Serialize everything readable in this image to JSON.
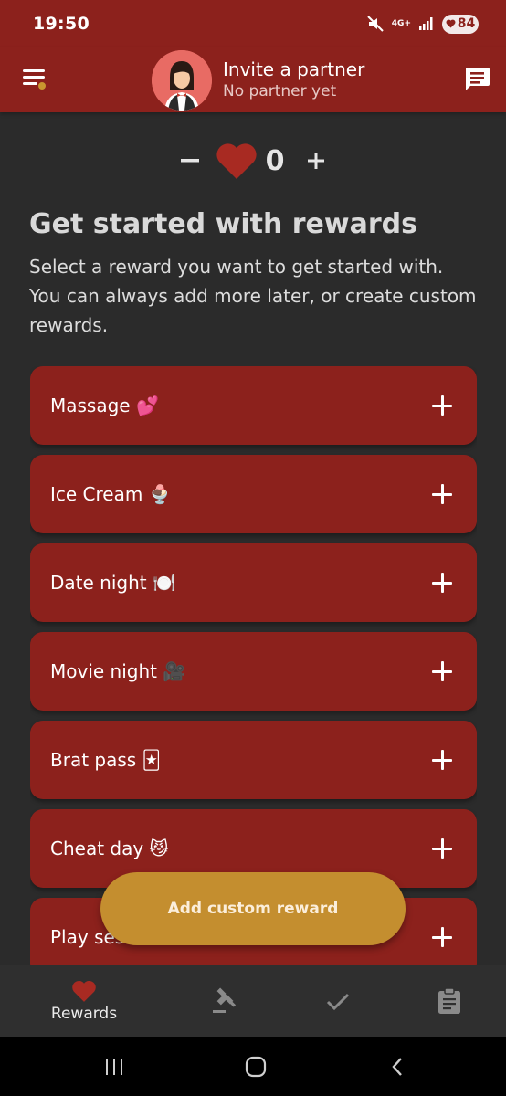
{
  "status_bar": {
    "time": "19:50",
    "network_label": "4G+",
    "battery": "84"
  },
  "header": {
    "partner_title": "Invite a partner",
    "partner_subtitle": "No partner yet",
    "menu_icon": "hamburger-menu-icon",
    "chat_icon": "chat-bubble-icon"
  },
  "counter": {
    "value": "0",
    "minus_label": "–",
    "plus_label": "+"
  },
  "intro": {
    "title": "Get started with rewards",
    "description": "Select a reward you want to get started with. You can always add more later, or create custom rewards."
  },
  "rewards": [
    {
      "label": "Massage 💕"
    },
    {
      "label": "Ice Cream 🍨"
    },
    {
      "label": "Date night 🍽️"
    },
    {
      "label": "Movie night 🎥"
    },
    {
      "label": "Brat pass 🃏"
    },
    {
      "label": "Cheat day 😼"
    },
    {
      "label": "Play session 🎮"
    }
  ],
  "fab": {
    "label": "Add custom reward"
  },
  "bottom_nav": [
    {
      "label": "Rewards",
      "icon": "heart-icon",
      "active": true
    },
    {
      "label": "",
      "icon": "gavel-icon",
      "active": false
    },
    {
      "label": "",
      "icon": "check-icon",
      "active": false
    },
    {
      "label": "",
      "icon": "clipboard-icon",
      "active": false
    }
  ],
  "colors": {
    "primary": "#8c211c",
    "background": "#2b2b2b",
    "accent": "#c48e2f",
    "heart": "#a82a22"
  }
}
